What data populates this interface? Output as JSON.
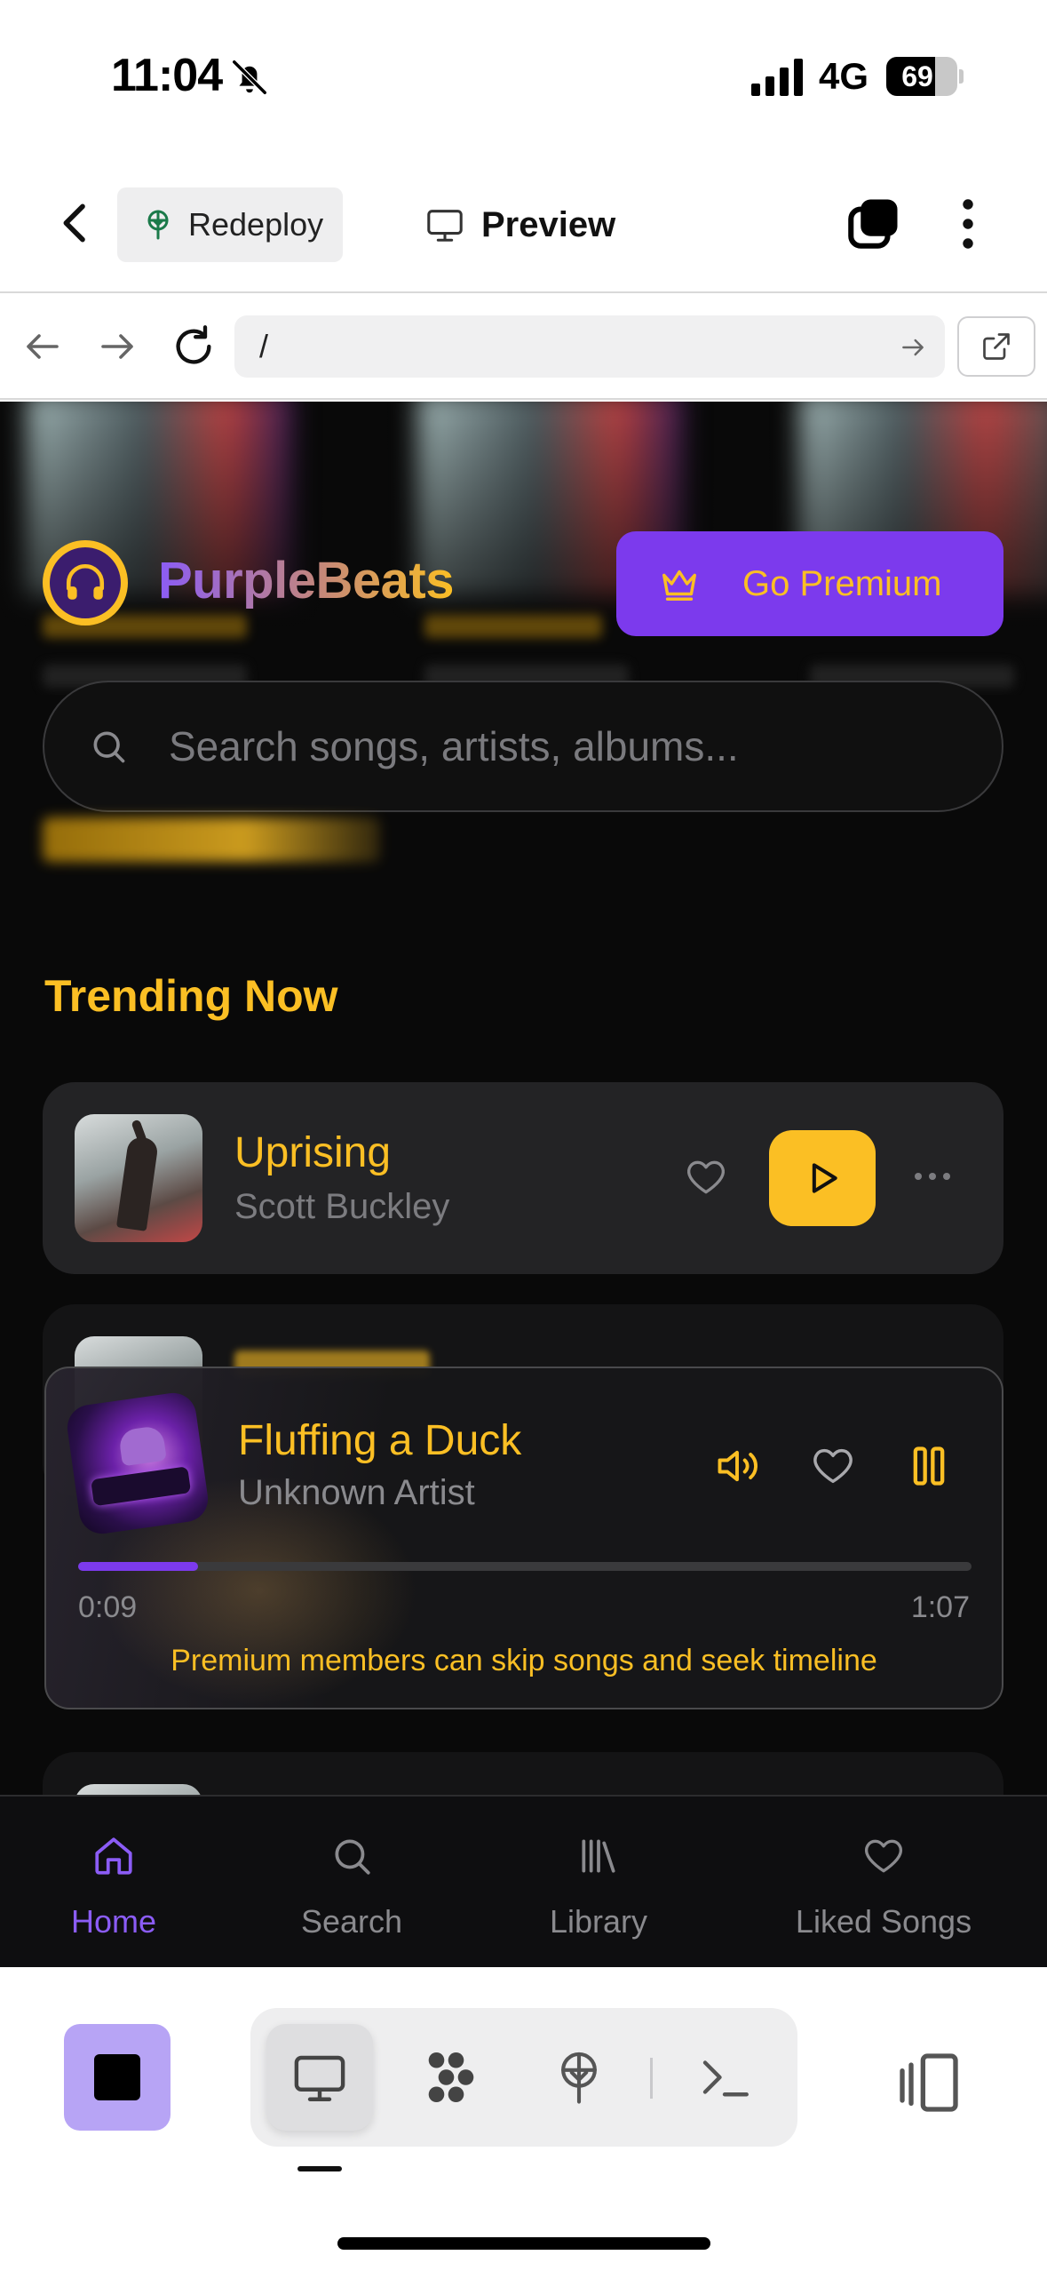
{
  "status_bar": {
    "time": "11:04",
    "network": "4G",
    "battery": "69",
    "battery_level": 0.69
  },
  "header": {
    "redeploy_label": "Redeploy",
    "preview_label": "Preview"
  },
  "browser": {
    "url": "/"
  },
  "app": {
    "brand": "PurpleBeats",
    "premium_label": "Go Premium",
    "search_placeholder": "Search songs, artists, albums...",
    "section_title": "Trending Now",
    "tracks": [
      {
        "title": "Uprising",
        "artist": "Scott Buckley"
      }
    ],
    "player": {
      "title": "Fluffing a Duck",
      "artist": "Unknown Artist",
      "elapsed": "0:09",
      "total": "1:07",
      "progress": 0.134,
      "note": "Premium members can skip songs and seek timeline"
    },
    "nav": [
      {
        "label": "Home",
        "icon": "home-icon",
        "active": true
      },
      {
        "label": "Search",
        "icon": "search-icon",
        "active": false
      },
      {
        "label": "Library",
        "icon": "library-icon",
        "active": false
      },
      {
        "label": "Liked Songs",
        "icon": "heart-icon",
        "active": false
      }
    ]
  },
  "colors": {
    "accent_purple": "#7c3aed",
    "accent_gold": "#fbbf24",
    "background": "#090909"
  }
}
